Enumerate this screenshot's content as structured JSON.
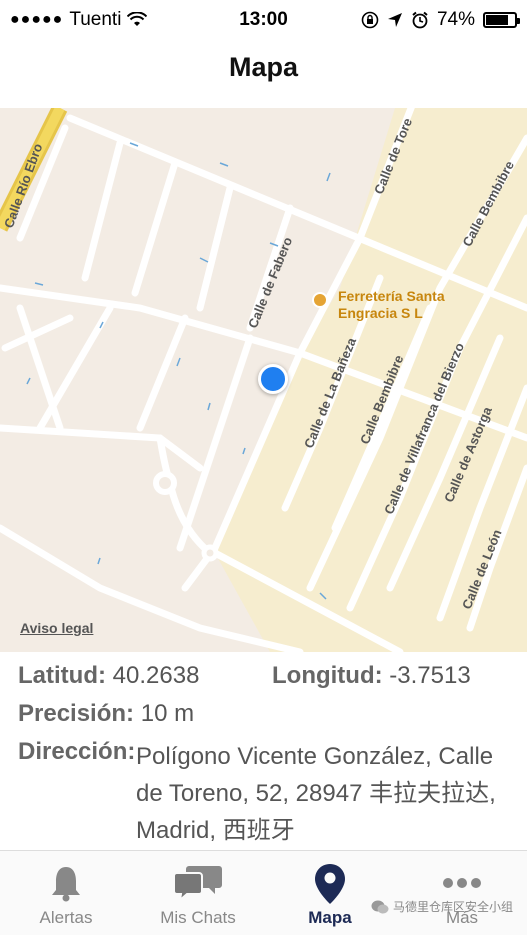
{
  "status_bar": {
    "carrier": "Tuenti",
    "time": "13:00",
    "battery": "74%",
    "battery_level": 0.74
  },
  "nav": {
    "title": "Mapa"
  },
  "map": {
    "streets": [
      "Calle Río Ebro",
      "Calle de Tore",
      "Calle Bembibre",
      "Calle de Fabero",
      "Calle de La Bañeza",
      "Calle Bembibre",
      "Calle de Villafranca del Bierzo",
      "Calle de Astorga",
      "Calle de León"
    ],
    "poi": {
      "line1": "Ferretería Santa",
      "line2": "Engracia S L"
    },
    "legal": "Aviso legal"
  },
  "info": {
    "lat_label": "Latitud:",
    "lat_value": "40.2638",
    "lon_label": "Longitud:",
    "lon_value": "-3.7513",
    "precision_label": "Precisión:",
    "precision_value": "10 m",
    "address_label": "Dirección:",
    "address_value": "Polígono Vicente González, Calle de Toreno, 52, 28947 丰拉夫拉达, Madrid, 西班牙"
  },
  "tabs": [
    {
      "label": "Alertas",
      "icon": "bell-icon"
    },
    {
      "label": "Mis Chats",
      "icon": "chat-bubbles-icon"
    },
    {
      "label": "Mapa",
      "icon": "map-pin-icon",
      "active": true
    },
    {
      "label": "Más",
      "icon": "more-dots-icon"
    }
  ],
  "watermark": "马德里仓库区安全小组",
  "colors": {
    "active_tab": "#1d2a55",
    "location_dot": "#1f7ff0",
    "poi": "#c7860e",
    "industrial_area": "#f6edcf"
  }
}
